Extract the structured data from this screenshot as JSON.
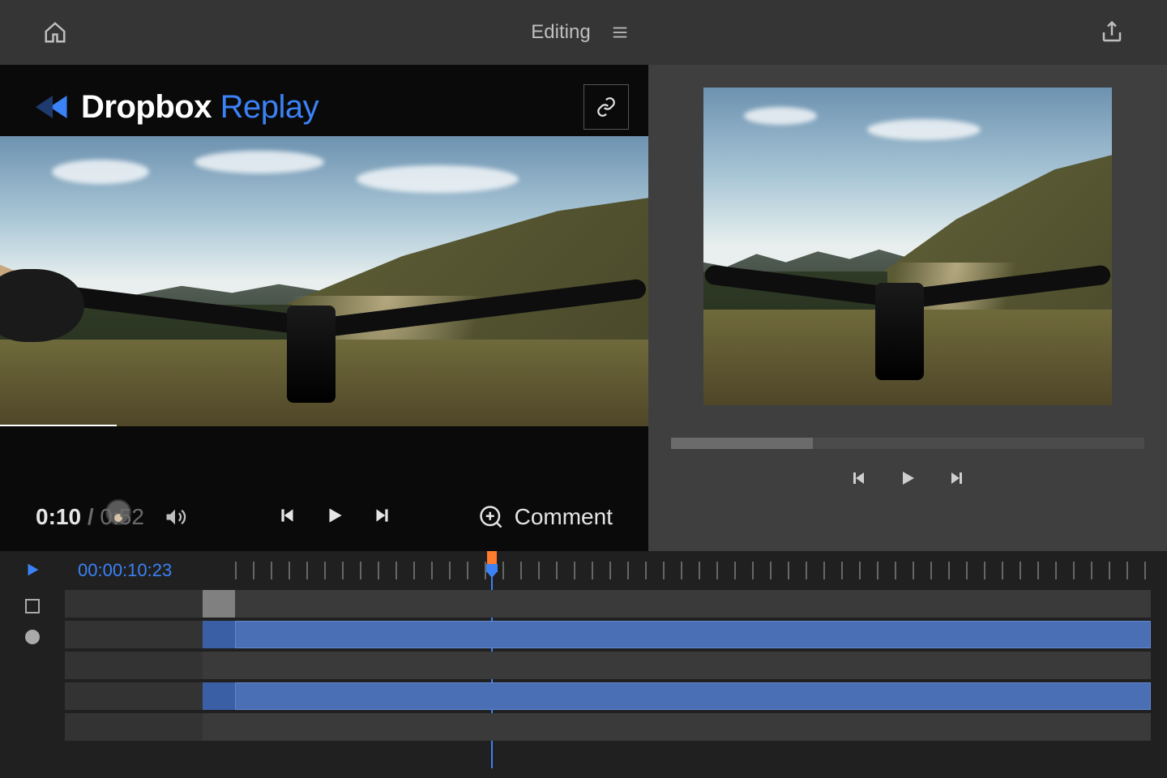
{
  "topbar": {
    "title": "Editing"
  },
  "replay": {
    "brand": "Dropbox",
    "product": "Replay",
    "current_time": "0:10",
    "duration": "0:52",
    "comment_label": "Comment"
  },
  "timeline": {
    "timecode": "00:00:10:23",
    "playhead_percent": 28,
    "tracks": [
      {
        "type": "grey",
        "start_pct": 0,
        "width_pct": 4
      },
      {
        "type": "blue",
        "start_pct": 0,
        "width_pct": 100
      },
      {
        "type": "dark",
        "start_pct": 0,
        "width_pct": 100
      },
      {
        "type": "blue",
        "start_pct": 0,
        "width_pct": 100
      },
      {
        "type": "dark",
        "start_pct": 0,
        "width_pct": 100
      }
    ]
  },
  "icons": {
    "home": "home",
    "menu": "menu",
    "share": "share",
    "link": "link",
    "volume": "volume",
    "prev_frame": "step-back",
    "play": "play",
    "next_frame": "step-forward",
    "add_comment": "plus-circle"
  }
}
